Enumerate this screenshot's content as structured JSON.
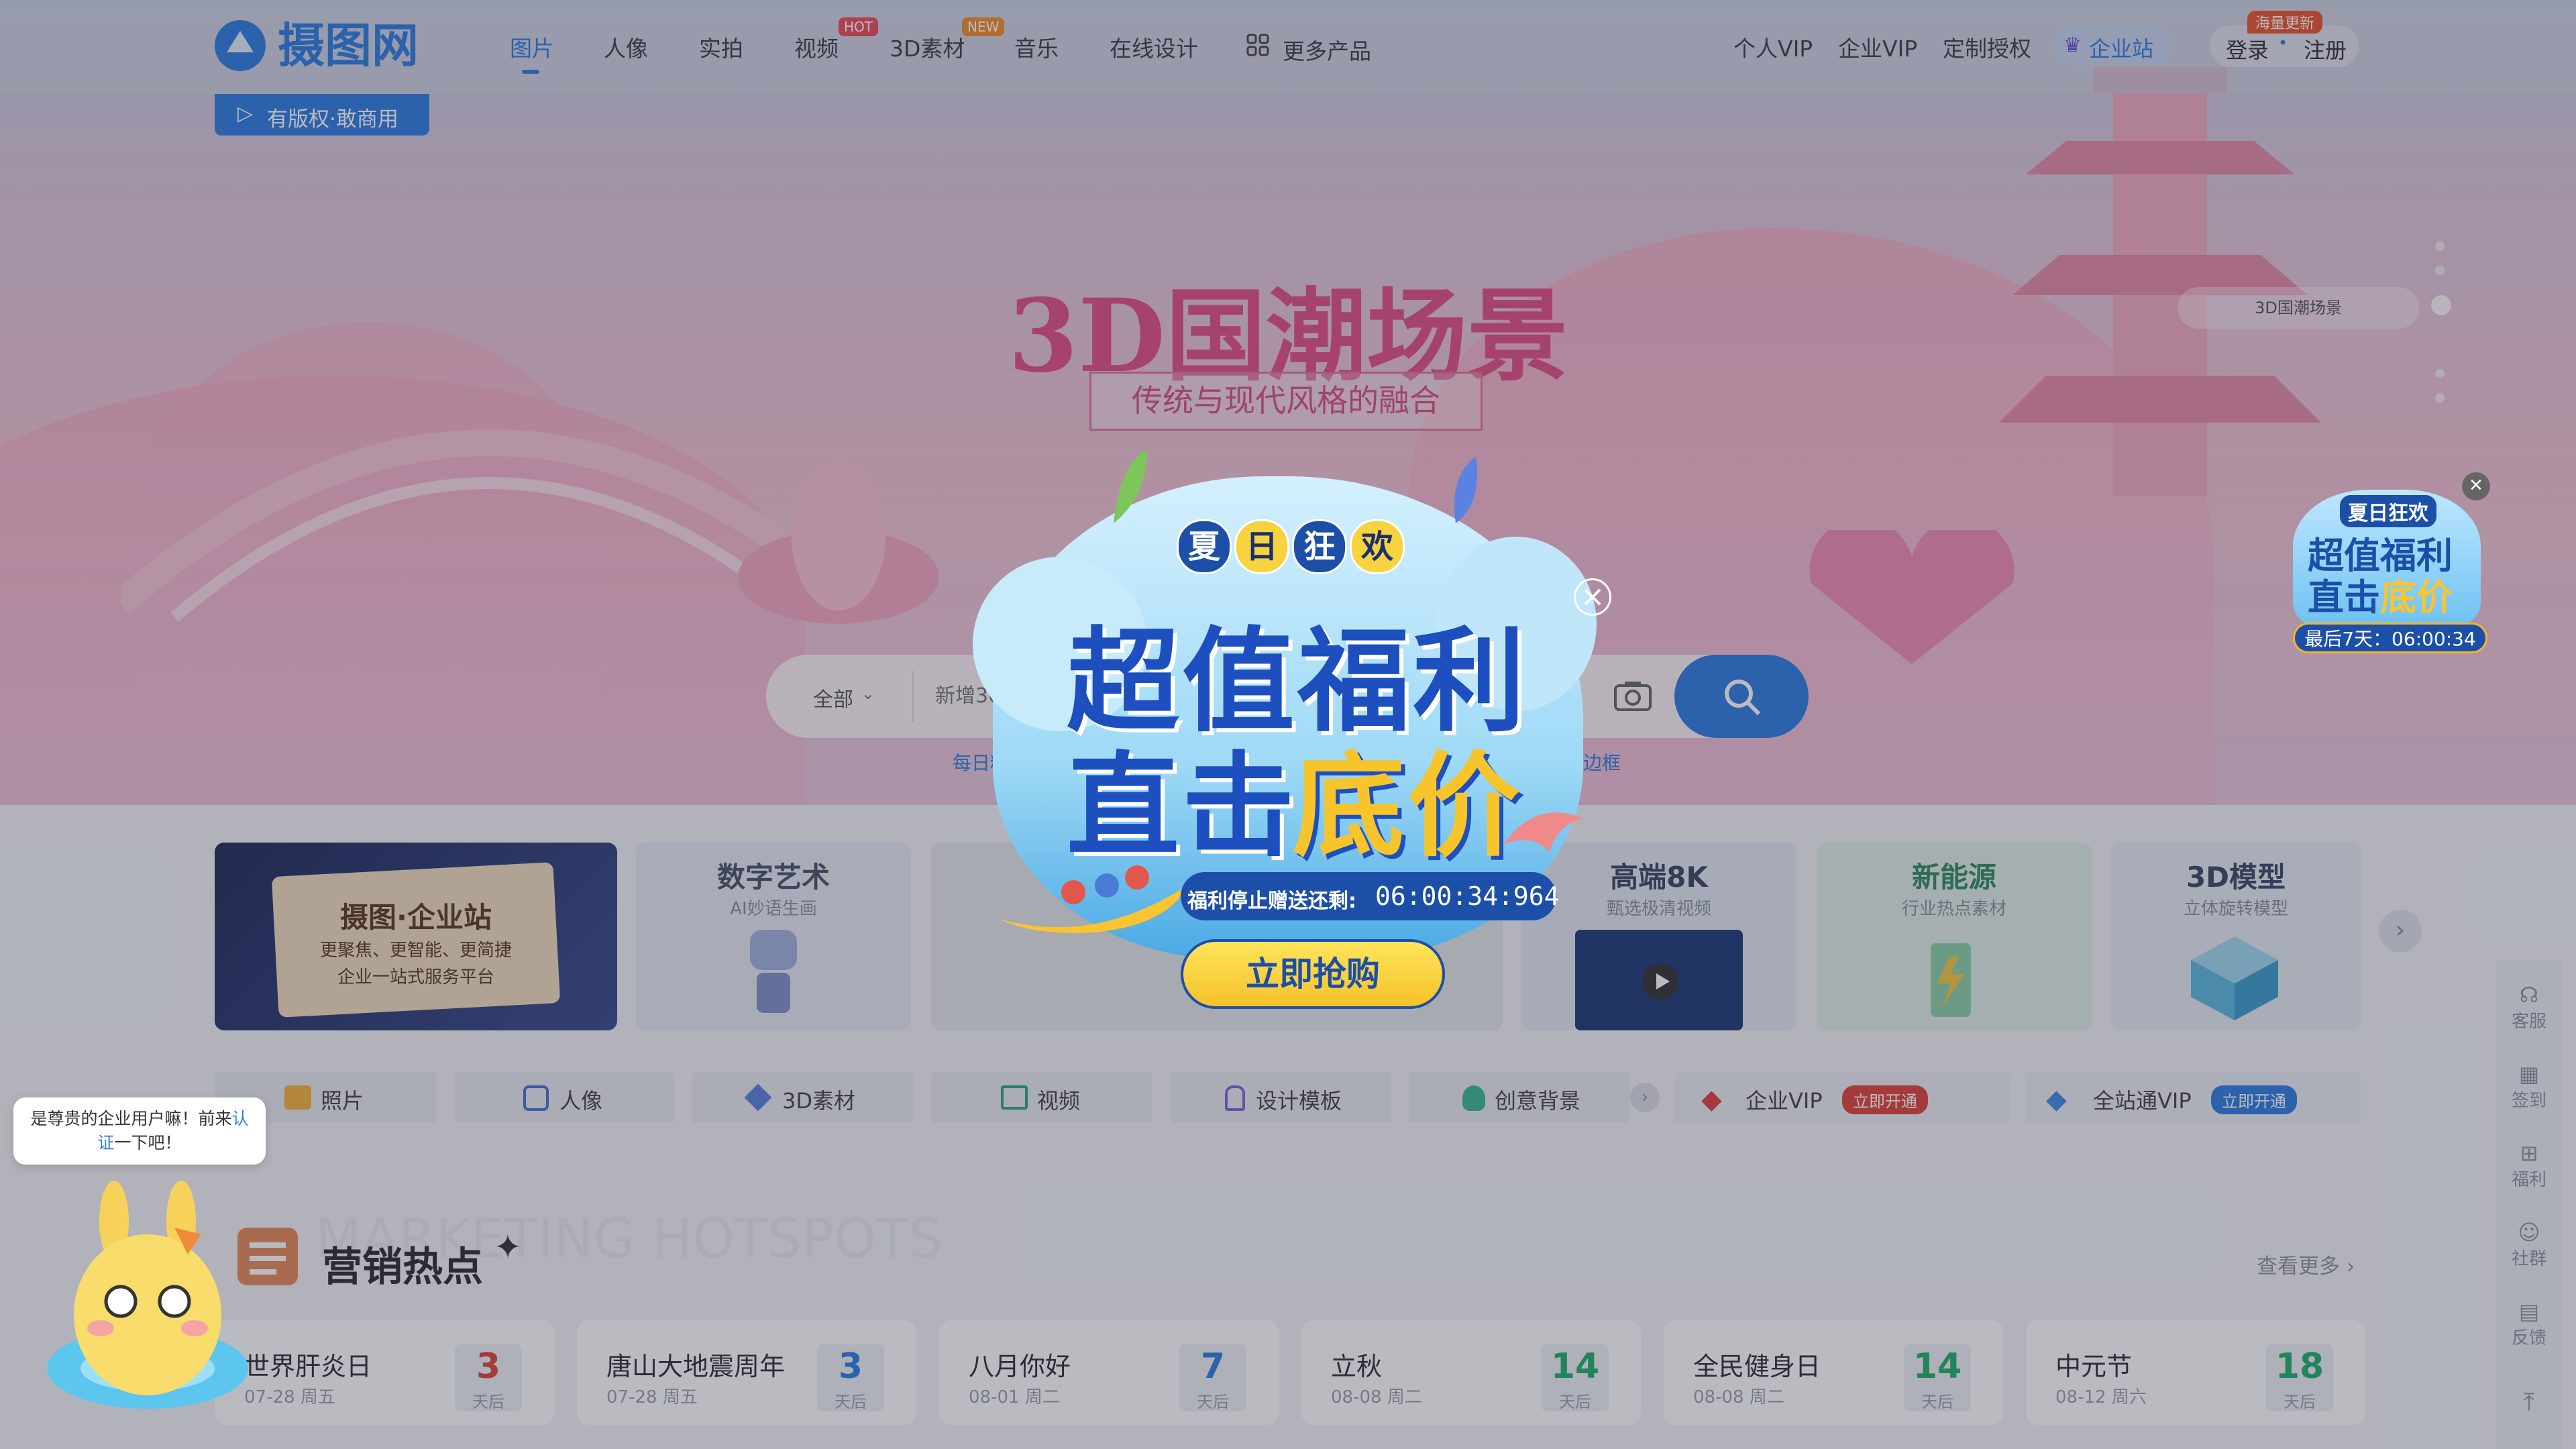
{
  "colors": {
    "brand": "#2f7de1",
    "vip_red": "#e0413b",
    "accent_yellow": "#f8d340"
  },
  "header": {
    "logo_text": "摄图网",
    "nav": [
      {
        "label": "图片",
        "active": true
      },
      {
        "label": "人像"
      },
      {
        "label": "实拍"
      },
      {
        "label": "视频",
        "tag": "HOT"
      },
      {
        "label": "3D素材",
        "tag": "NEW"
      },
      {
        "label": "音乐"
      },
      {
        "label": "在线设计"
      },
      {
        "label": "更多产品",
        "icon": "grid-icon"
      }
    ],
    "right": {
      "personal_vip": "个人VIP",
      "enterprise_vip": "企业VIP",
      "custom_license": "定制授权",
      "enterprise_site": "企业站",
      "login": "登录",
      "register": "注册",
      "update_badge": "海量更新",
      "sep": "•"
    }
  },
  "banner": {
    "copyright_badge": "有版权·敢商用",
    "title": "3D国潮场景",
    "subtitle": "传统与现代风格的融合",
    "slide_label": "3D国潮场景"
  },
  "search": {
    "scope": "全部",
    "placeholder": "新增30",
    "hint_left": "每日精",
    "hint_right": "边框"
  },
  "popup": {
    "tag_chars": [
      "夏",
      "日",
      "狂",
      "欢"
    ],
    "line1": "超值福利",
    "line2a": "直击",
    "line2b": "底价",
    "countdown_label": "福利停止赠送还剩:",
    "countdown": "06:00:34:964",
    "cta": "立即抢购"
  },
  "float_ad": {
    "tag": "夏日狂欢",
    "line1": "超值福利",
    "line2a": "直击",
    "line2b": "底价",
    "countdown": "最后7天：06:00:34"
  },
  "categories": [
    {
      "title": "摄图·企业站",
      "sub": "更聚焦、更智能、更简捷",
      "sub2": "企业一站式服务平台"
    },
    {
      "title": "数字艺术",
      "sub": "AI妙语生画"
    },
    {
      "title": "",
      "sub": ""
    },
    {
      "title": "高端8K",
      "sub": "甄选极清视频"
    },
    {
      "title": "新能源",
      "sub": "行业热点素材"
    },
    {
      "title": "3D模型",
      "sub": "立体旋转模型"
    }
  ],
  "tabs": [
    {
      "label": "照片",
      "icon": "photo-icon"
    },
    {
      "label": "人像",
      "icon": "portrait-icon"
    },
    {
      "label": "3D素材",
      "icon": "cube-icon"
    },
    {
      "label": "视频",
      "icon": "film-icon"
    },
    {
      "label": "设计模板",
      "icon": "template-icon"
    },
    {
      "label": "创意背景",
      "icon": "bulb-icon"
    }
  ],
  "vip_tabs": [
    {
      "label": "企业VIP",
      "action": "立即开通"
    },
    {
      "label": "全站通VIP",
      "action": "立即开通"
    }
  ],
  "marketing": {
    "bg_text": "MARKETING HOTSPOTS",
    "title": "营销热点",
    "more": "查看更多 ›",
    "items": [
      {
        "name": "世界肝炎日",
        "date": "07-28 周五",
        "days": "3",
        "unit": "天后",
        "color": "#e0413b"
      },
      {
        "name": "唐山大地震周年",
        "date": "07-28 周五",
        "days": "3",
        "unit": "天后",
        "color": "#2f7de1"
      },
      {
        "name": "八月你好",
        "date": "08-01 周二",
        "days": "7",
        "unit": "天后",
        "color": "#2f7de1"
      },
      {
        "name": "立秋",
        "date": "08-08 周二",
        "days": "14",
        "unit": "天后",
        "color": "#1fae6b"
      },
      {
        "name": "全民健身日",
        "date": "08-08 周二",
        "days": "14",
        "unit": "天后",
        "color": "#1fae6b"
      },
      {
        "name": "中元节",
        "date": "08-12 周六",
        "days": "18",
        "unit": "天后",
        "color": "#1fae6b"
      }
    ]
  },
  "sidebar": [
    {
      "label": "客服",
      "icon": "headset-icon"
    },
    {
      "label": "签到",
      "icon": "calendar-icon"
    },
    {
      "label": "福利",
      "icon": "gift-icon"
    },
    {
      "label": "社群",
      "icon": "community-icon"
    },
    {
      "label": "反馈",
      "icon": "feedback-icon"
    }
  ],
  "toast": {
    "text_a": "是尊贵的企业用户嘛！前来",
    "link": "认",
    "text_b": "证",
    "text_c": "一下吧！"
  }
}
